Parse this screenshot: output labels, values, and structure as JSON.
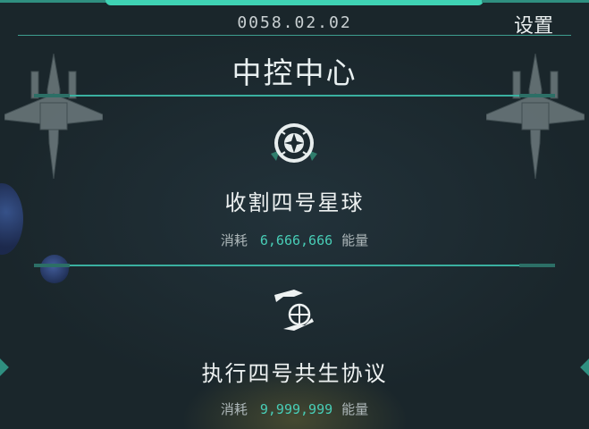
{
  "header": {
    "date": "0058.02.02",
    "settings_label": "设置"
  },
  "title": "中控中心",
  "actions": [
    {
      "title": "收割四号星球",
      "cost_label": "消耗",
      "cost_value": "6,666,666",
      "cost_unit": "能量",
      "icon": "harvest-planet-icon"
    },
    {
      "title": "执行四号共生协议",
      "cost_label": "消耗",
      "cost_value": "9,999,999",
      "cost_unit": "能量",
      "icon": "symbiosis-protocol-icon"
    }
  ],
  "colors": {
    "accent": "#3fd2b4",
    "value": "#48cdb6",
    "background": "#1c2a30"
  }
}
